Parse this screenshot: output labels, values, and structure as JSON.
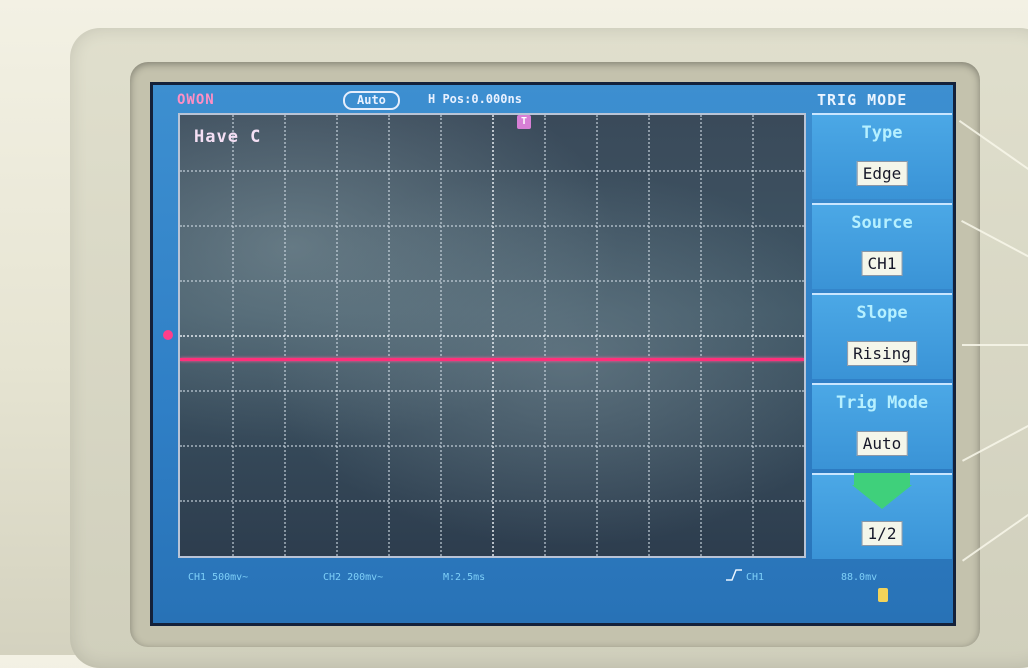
{
  "brand": "OWON",
  "status": {
    "run_mode": "Auto",
    "horizontal_position": "H Pos:0.000ns"
  },
  "plot": {
    "overlay_text": "Have C",
    "trigger_position_marker": "T",
    "trace_color": "#ff2f7a",
    "trace_level_fraction": 0.55
  },
  "menu": {
    "title": "TRIG MODE",
    "items": [
      {
        "label": "Type",
        "value": "Edge"
      },
      {
        "label": "Source",
        "value": "CH1"
      },
      {
        "label": "Slope",
        "value": "Rising"
      },
      {
        "label": "Trig Mode",
        "value": "Auto"
      },
      {
        "label": "",
        "value": "1/2"
      }
    ]
  },
  "bottom": {
    "ch1": "CH1 500mv~",
    "ch2": "CH2 200mv~",
    "timebase": "M:2.5ms",
    "trigger_source": "CH1",
    "trigger_level": "88.0mv"
  },
  "colors": {
    "screen_bg": "#2f7fc6",
    "menu_value_bg": "#f4f6ea",
    "accent_pink": "#ff8fc4",
    "page_arrow": "#3fd07b"
  }
}
